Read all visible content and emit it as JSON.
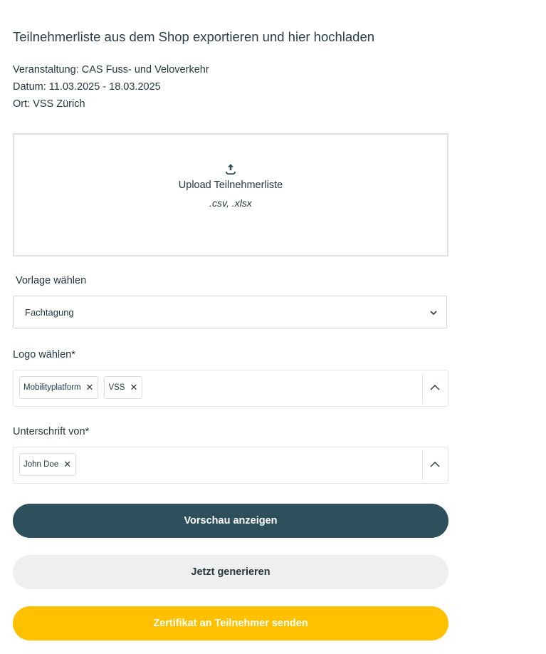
{
  "page": {
    "title": "Teilnehmerliste aus dem Shop exportieren und hier hochladen",
    "event_line": "Veranstaltung: CAS Fuss- und Veloverkehr",
    "date_line": "Datum: 11.03.2025 - 18.03.2025",
    "place_line": "Ort: VSS Zürich"
  },
  "upload": {
    "icon": "upload-icon",
    "label": "Upload Teilnehmerliste",
    "types": ".csv, .xlsx"
  },
  "template": {
    "label": "Vorlage wählen",
    "value": "Fachtagung"
  },
  "logo": {
    "label": "Logo wählen*",
    "chips": [
      "Mobilityplatform",
      "VSS"
    ]
  },
  "signature": {
    "label": "Unterschrift von*",
    "chips": [
      "John Doe"
    ]
  },
  "buttons": {
    "preview": "Vorschau anzeigen",
    "generate": "Jetzt generieren",
    "send": "Zertifikat an Teilnehmer senden"
  },
  "colors": {
    "primary": "#2e4f5c",
    "secondary": "#efefef",
    "accent": "#ffc000",
    "text": "#24363f"
  }
}
